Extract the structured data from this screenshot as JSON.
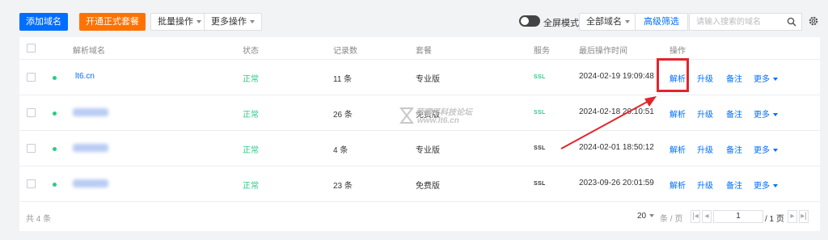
{
  "toolbar": {
    "add_domain": "添加域名",
    "open_plan": "开通正式套餐",
    "batch_ops": "批量操作",
    "more_ops": "更多操作",
    "fullscreen_mode": "全屏模式",
    "domain_filter": "全部域名",
    "advanced_filter": "高级筛选",
    "search_placeholder": "请输入搜索的域名"
  },
  "table": {
    "headers": {
      "domain": "解析域名",
      "status": "状态",
      "records": "记录数",
      "plan": "套餐",
      "service": "服务",
      "last_op": "最后操作时间",
      "actions": "操作"
    },
    "rows": [
      {
        "domain": "lt6.cn",
        "status": "正常",
        "records": "11 条",
        "plan": "专业版",
        "service": "SSL",
        "last_op": "2024-02-19 19:09:48",
        "act_resolve": "解析",
        "act_upgrade": "升级",
        "act_note": "备注",
        "act_more": "更多"
      },
      {
        "domain": "",
        "status": "正常",
        "records": "26 条",
        "plan": "免费版",
        "service": "SSL",
        "last_op": "2024-02-18 20:10:51",
        "act_resolve": "解析",
        "act_upgrade": "升级",
        "act_note": "备注",
        "act_more": "更多"
      },
      {
        "domain": "",
        "status": "正常",
        "records": "4 条",
        "plan": "专业版",
        "service": "SSL",
        "last_op": "2024-02-01 18:50:12",
        "act_resolve": "解析",
        "act_upgrade": "升级",
        "act_note": "备注",
        "act_more": "更多"
      },
      {
        "domain": "",
        "status": "正常",
        "records": "23 条",
        "plan": "免费版",
        "service": "SSL",
        "last_op": "2023-09-26 20:01:59",
        "act_resolve": "解析",
        "act_upgrade": "升级",
        "act_note": "备注",
        "act_more": "更多"
      }
    ]
  },
  "footer": {
    "total": "共 4 条",
    "page_size": "20",
    "per_page_unit": "条 / 页",
    "current_page": "1",
    "total_pages": "/ 1 页"
  },
  "watermark": {
    "line1": "薛耀平科技论坛",
    "line2": "www.lt6.cn"
  },
  "colors": {
    "primary": "#006eff",
    "orange": "#ff7200",
    "success": "#29cc85",
    "highlight": "#e0262d"
  }
}
